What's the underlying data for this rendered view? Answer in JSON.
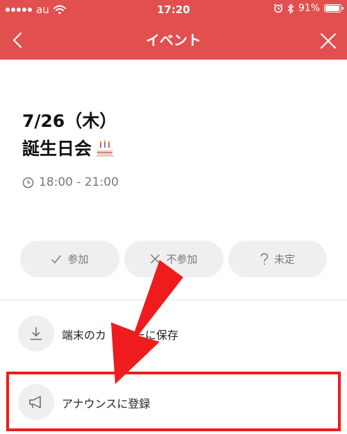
{
  "status_bar": {
    "carrier": "au",
    "time": "17:20",
    "battery": "91%",
    "icons": [
      "signal-dots-icon",
      "wifi-icon",
      "alarm-icon",
      "bluetooth-icon",
      "battery-icon"
    ]
  },
  "nav": {
    "title": "イベント",
    "back_icon": "chevron-left-icon",
    "close_icon": "close-icon"
  },
  "event": {
    "date": "7/26（木）",
    "title": "誕生日会",
    "title_emoji": "birthday-cake-icon",
    "time_range": "18:00 - 21:00"
  },
  "rsvp": {
    "attend": "参加",
    "decline": "不参加",
    "undecided": "未定"
  },
  "actions": {
    "save_to_device": "端末のカ",
    "save_to_device_suffix": "ーに保存",
    "announce": "アナウンスに登録"
  },
  "colors": {
    "header": "#e24f4f",
    "highlight": "#ee1c1c",
    "button_bg": "#efefef"
  }
}
